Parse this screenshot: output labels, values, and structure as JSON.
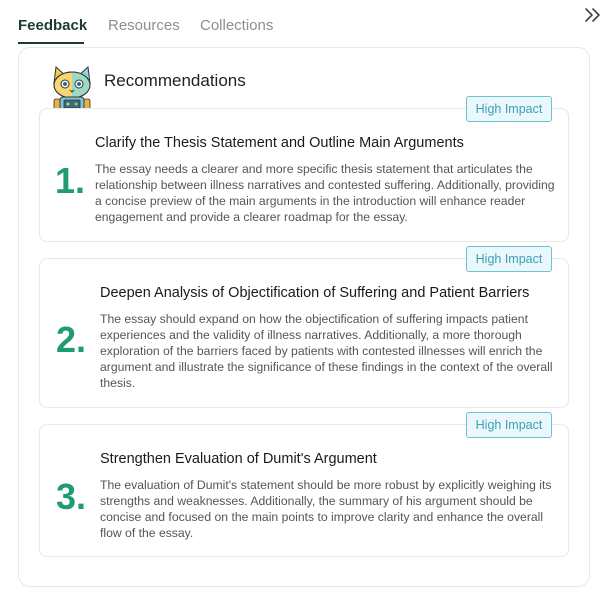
{
  "tabs": [
    {
      "label": "Feedback",
      "active": true
    },
    {
      "label": "Resources",
      "active": false
    },
    {
      "label": "Collections",
      "active": false
    }
  ],
  "header": {
    "collapse_icon": "double-chevron-right-icon"
  },
  "panel": {
    "title": "Recommendations",
    "mascot_icon": "cat-robot-mascot",
    "recommendations": [
      {
        "number": "1.",
        "badge": "High Impact",
        "title": "Clarify the Thesis Statement and Outline Main Arguments",
        "body": "The essay needs a clearer and more specific thesis statement that articulates the relationship between illness narratives and contested suffering. Additionally, providing a concise preview of the main arguments in the introduction will enhance reader engagement and provide a clearer roadmap for the essay."
      },
      {
        "number": "2.",
        "badge": "High Impact",
        "title": "Deepen Analysis of Objectification of Suffering and Patient Barriers",
        "body": "The essay should expand on how the objectification of suffering impacts patient experiences and the validity of illness narratives. Additionally, a more thorough exploration of the barriers faced by patients with contested illnesses will enrich the argument and illustrate the significance of these findings in the context of the overall thesis."
      },
      {
        "number": "3.",
        "badge": "High Impact",
        "title": "Strengthen Evaluation of Dumit's Argument",
        "body": "The evaluation of Dumit's statement should be more robust by explicitly weighing its strengths and weaknesses. Additionally, the summary of his argument should be concise and focused on the main points to improve clarity and enhance the overall flow of the essay."
      }
    ]
  },
  "colors": {
    "accent_green": "#1f9d6e",
    "tab_active": "#1f3b30",
    "badge_border": "#6cc3d6",
    "badge_bg": "#eaf8fb",
    "badge_text": "#3a9fb8"
  }
}
